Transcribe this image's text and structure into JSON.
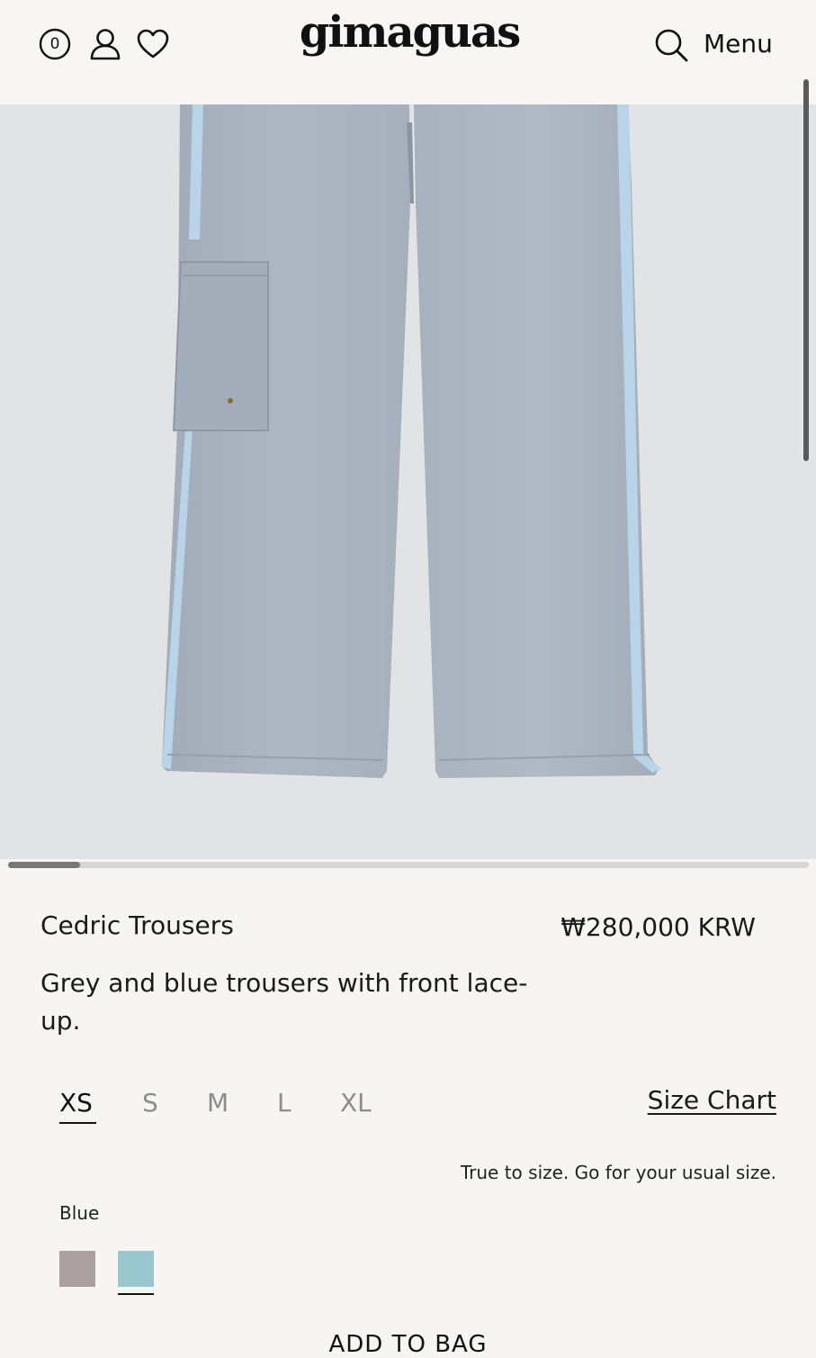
{
  "header": {
    "cart_count": "0",
    "logo": "gimaguas",
    "menu_label": "Menu"
  },
  "product": {
    "name": "Cedric Trousers",
    "price": "₩280,000 KRW",
    "description": "Grey and blue trousers with front lace-up.",
    "image_icon": "trousers-image",
    "carousel_progress": 0.09,
    "sizes": [
      "XS",
      "S",
      "M",
      "L",
      "XL"
    ],
    "selected_size": "XS",
    "size_chart_label": "Size Chart",
    "fit_note": "True to size. Go for your usual size.",
    "color_label": "Blue",
    "colors": [
      {
        "hex": "#ab9f9f"
      },
      {
        "hex": "#9ac6cd"
      }
    ],
    "selected_color_index": 1,
    "add_to_bag_label": "ADD TO BAG"
  },
  "icons": [
    "bag-icon",
    "account-icon",
    "heart-icon",
    "search-icon"
  ],
  "colors": {
    "background": "#f7f5f4",
    "image_bg": "#e2e3e5",
    "trouser_grey": "#a9b3bf",
    "trouser_stripe": "#b9d3e8"
  }
}
